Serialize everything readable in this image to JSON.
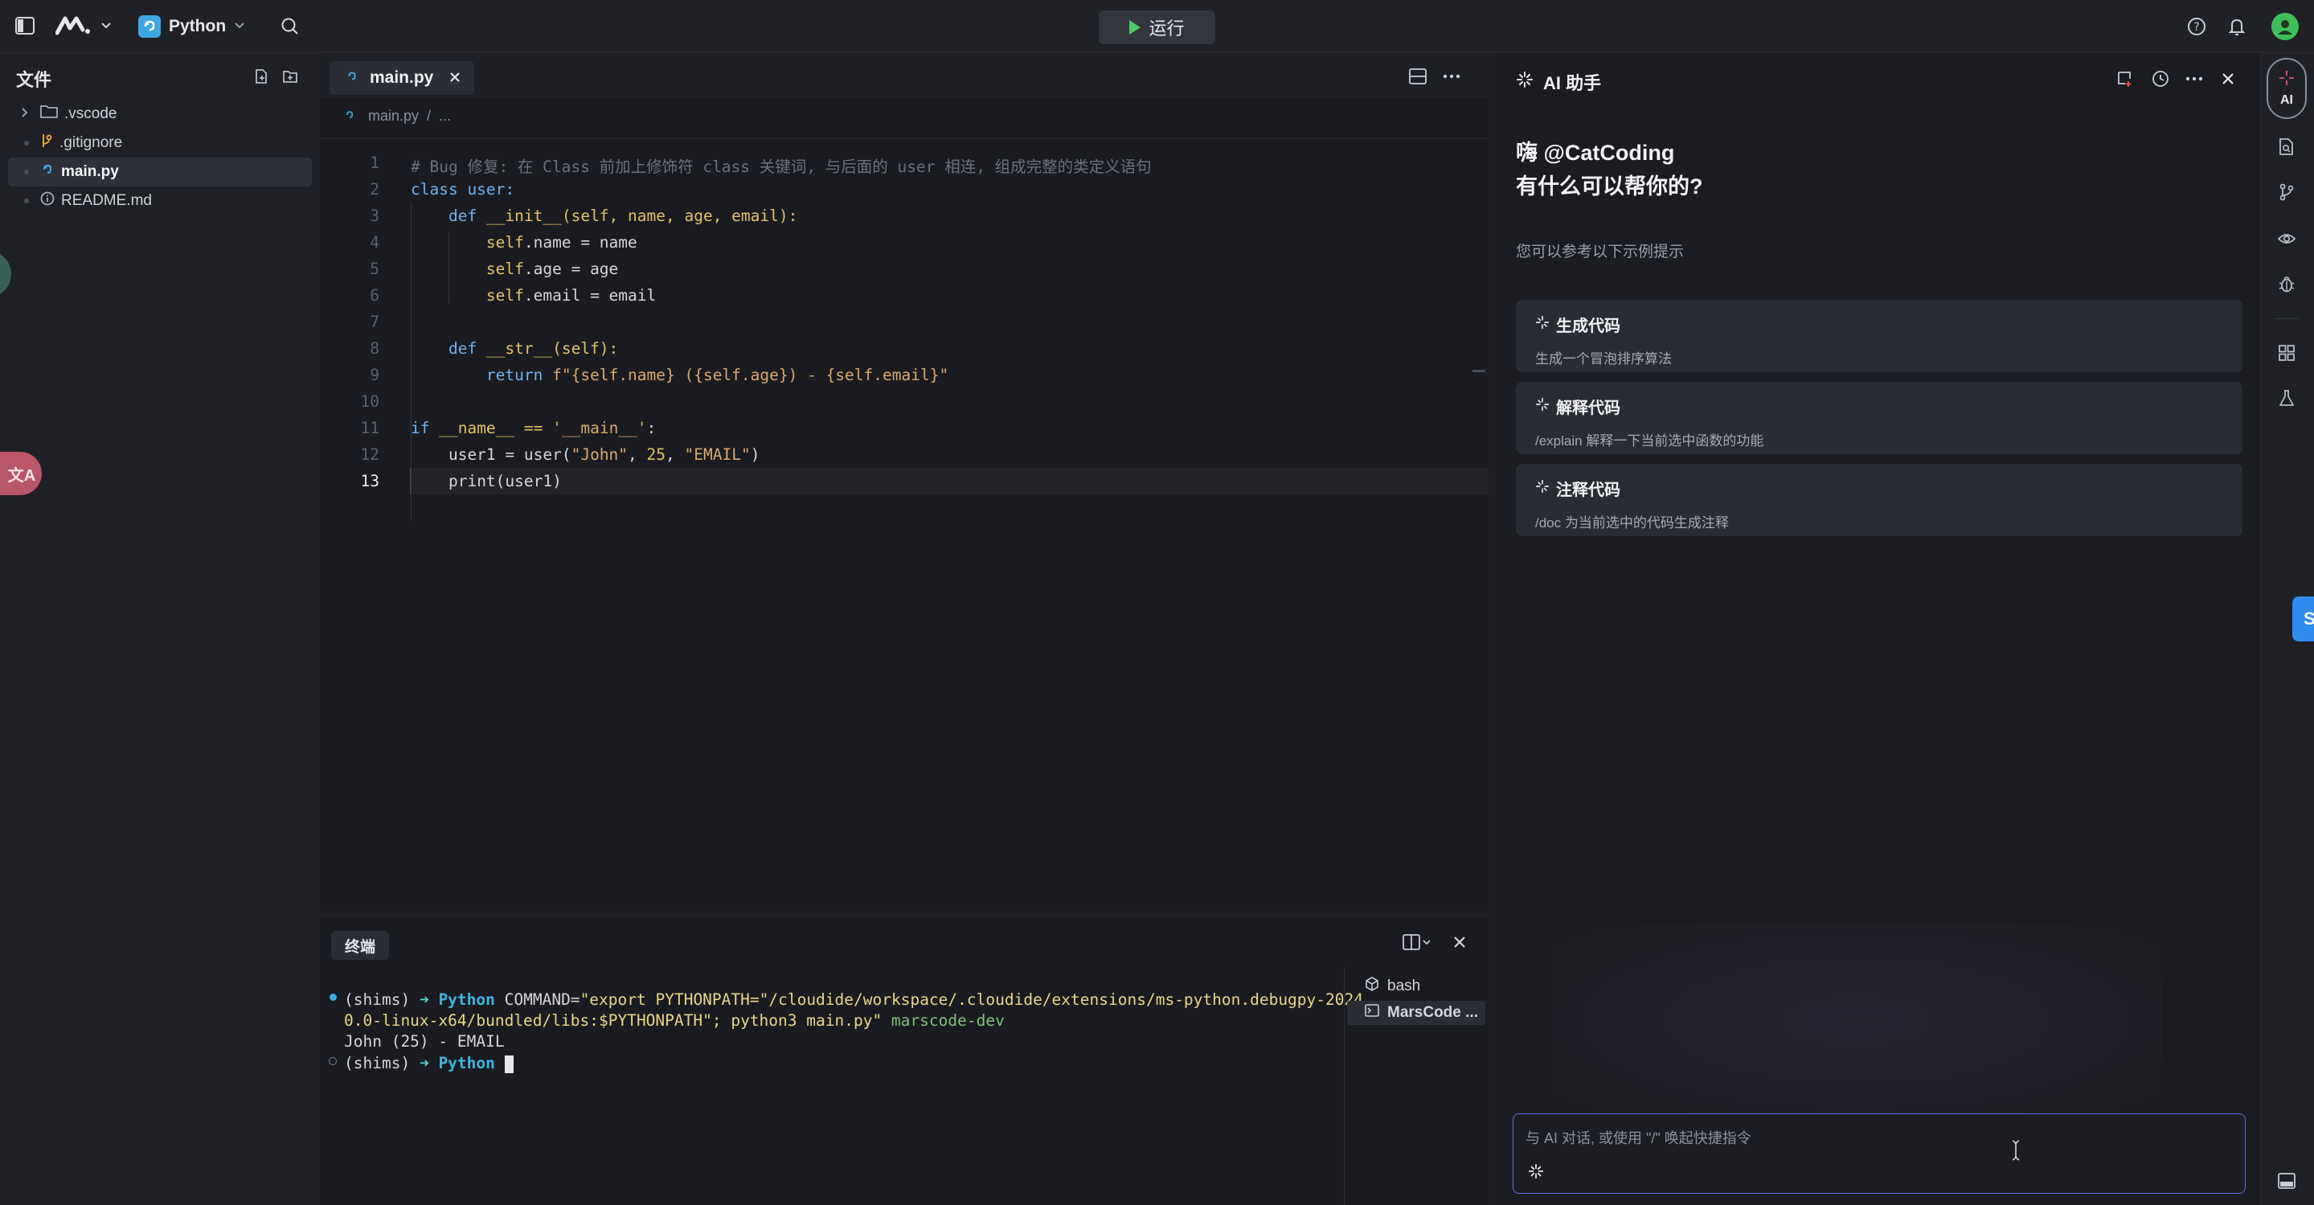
{
  "topbar": {
    "language": "Python",
    "run_label": "运行"
  },
  "sidebar": {
    "title": "文件",
    "items": [
      {
        "label": ".vscode",
        "type": "folder"
      },
      {
        "label": ".gitignore",
        "type": "git"
      },
      {
        "label": "main.py",
        "type": "python",
        "active": true
      },
      {
        "label": "README.md",
        "type": "info"
      }
    ]
  },
  "editor": {
    "tab_label": "main.py",
    "breadcrumb": [
      "main.py",
      "/",
      "..."
    ],
    "lines": [
      {
        "n": "1"
      },
      {
        "n": "2"
      },
      {
        "n": "3"
      },
      {
        "n": "4"
      },
      {
        "n": "5"
      },
      {
        "n": "6"
      },
      {
        "n": "7"
      },
      {
        "n": "8"
      },
      {
        "n": "9"
      },
      {
        "n": "10"
      },
      {
        "n": "11"
      },
      {
        "n": "12"
      },
      {
        "n": "13"
      }
    ],
    "code": {
      "l1": "# Bug 修复: 在 Class 前加上修饰符 class 关键词, 与后面的 user 相连, 组成完整的类定义语句",
      "l2a": "class",
      "l2b": " user:",
      "l3a": "    def ",
      "l3b": "__init__",
      "l3c": "(self, name, age, email):",
      "l4a": "        self",
      "l4b": ".name = name",
      "l5a": "        self",
      "l5b": ".age = age",
      "l6a": "        self",
      "l6b": ".email = email",
      "l8a": "    def ",
      "l8b": "__str__",
      "l8c": "(self):",
      "l9a": "        return ",
      "l9b": "f\"{self.name} ({self.age}) - {self.email}\"",
      "l11a": "if ",
      "l11b": "__name__ == ",
      "l11c": "'__main__'",
      "l11d": ":",
      "l12a": "    user1 = user(",
      "l12b": "\"John\"",
      "l12c": ", ",
      "l12d": "25",
      "l12e": ", ",
      "l12f": "\"EMAIL\"",
      "l12g": ")",
      "l13a": "    ",
      "l13b": "print",
      "l13c": "(user1)"
    }
  },
  "terminal": {
    "tab_label": "终端",
    "line1_prefix": "(shims)",
    "arrow": "➜",
    "python": "Python",
    "line1_cmd": " COMMAND=",
    "line1_str": "\"export PYTHONPATH=\"/cloudide/workspace/.cloudide/extensions/ms-python.debugpy-2024.",
    "line2_str": "0.0-linux-x64/bundled/libs:$PYTHONPATH\"; python3 main.py\"",
    "line2_tail": " marscode-dev",
    "line3": "John (25) - EMAIL",
    "sessions": [
      "bash",
      "MarsCode ..."
    ]
  },
  "ai": {
    "title": "AI 助手",
    "greet1": "嗨 @CatCoding",
    "greet2": "有什么可以帮你的?",
    "hint": "您可以参考以下示例提示",
    "suggestions": [
      {
        "title": "生成代码",
        "desc": "生成一个冒泡排序算法"
      },
      {
        "title": "解释代码",
        "desc": "/explain 解释一下当前选中函数的功能"
      },
      {
        "title": "注释代码",
        "desc": "/doc 为当前选中的代码生成注释"
      }
    ],
    "input_placeholder": "与 AI 对话, 或使用 \"/\" 唤起快捷指令",
    "activity_label": "AI"
  },
  "colors": {
    "accent": "#5b6bd8",
    "run_green": "#4ec96a",
    "avatar_green": "#3fbf5a"
  }
}
